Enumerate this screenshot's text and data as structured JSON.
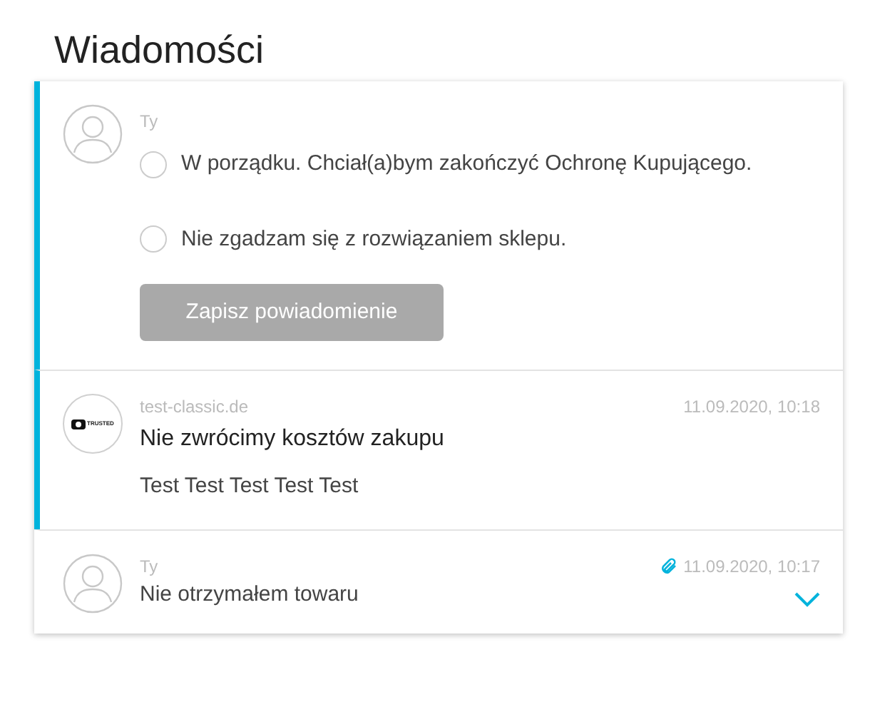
{
  "title": "Wiadomości",
  "messages": [
    {
      "kind": "form",
      "highlighted": true,
      "author": "Ty",
      "options": [
        {
          "label": "W porządku. Chciał(a)bym zakończyć Ochronę Kupującego.",
          "selected": false
        },
        {
          "label": "Nie zgadzam się z rozwiązaniem sklepu.",
          "selected": false
        }
      ],
      "button": {
        "label": "Zapisz powiadomienie",
        "disabled": true
      }
    },
    {
      "kind": "message",
      "highlighted": true,
      "author": "test-classic.de",
      "logo_text": "TRUSTED",
      "date": "11.09.2020, 10:18",
      "subject": "Nie zwrócimy kosztów zakupu",
      "body": "Test Test Test Test Test"
    },
    {
      "kind": "collapsed",
      "highlighted": false,
      "author": "Ty",
      "attachment": true,
      "date": "11.09.2020, 10:17",
      "subject": "Nie otrzymałem towaru",
      "expanded": false
    }
  ]
}
